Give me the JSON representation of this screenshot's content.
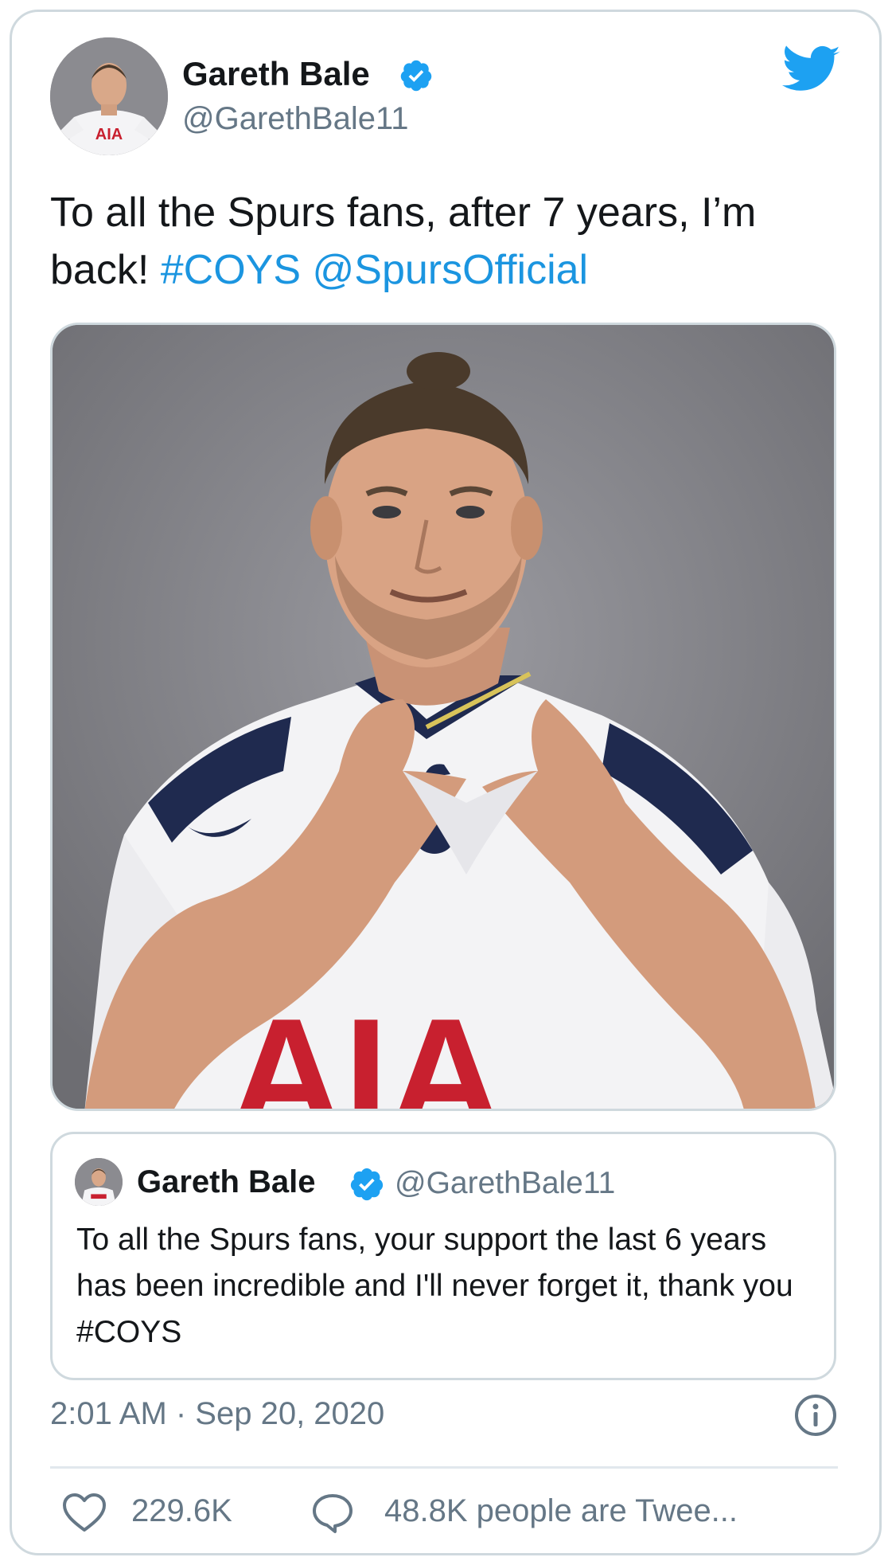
{
  "tweet": {
    "author": {
      "display_name": "Gareth Bale",
      "handle": "@GarethBale11",
      "verified": true,
      "avatar_shirt_text": "AIA"
    },
    "text_parts": [
      "To all the Spurs fans, after 7 years, I’m back! ",
      "#COYS",
      " ",
      "@SpursOfficial"
    ],
    "media": {
      "shirt_text": "AIA"
    },
    "quoted_tweet": {
      "display_name": "Gareth Bale",
      "handle": "@GarethBale11",
      "verified": true,
      "text": "To all the Spurs fans, your support the last 6 years has been incredible and I'll never forget it, thank you #COYS"
    },
    "timestamp": "2:01 AM · Sep 20, 2020",
    "likes": "229.6K",
    "replies_text": "48.8K people are Twee..."
  },
  "colors": {
    "link": "#1b95e0",
    "twitter_blue": "#1da1f2",
    "secondary_text": "#657786",
    "border": "#cfd9de"
  },
  "icons": [
    "twitter-bird-icon",
    "verified-badge-icon",
    "info-icon",
    "heart-icon",
    "speech-bubble-icon"
  ]
}
